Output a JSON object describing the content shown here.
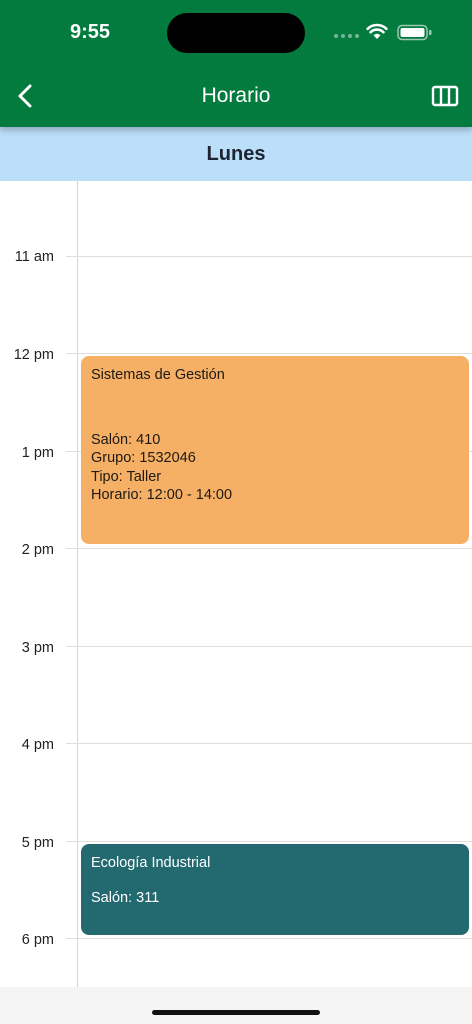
{
  "status_bar": {
    "time": "9:55"
  },
  "nav": {
    "title": "Horario",
    "back_icon": "chevron-left-icon",
    "view_icon": "view-week-icon"
  },
  "day": {
    "label": "Lunes"
  },
  "hours": [
    "11 am",
    "12 pm",
    "1 pm",
    "2 pm",
    "3 pm",
    "4 pm",
    "5 pm",
    "6 pm"
  ],
  "events": [
    {
      "title": "Sistemas de Gestión",
      "salon": "Salón: 410",
      "grupo": "Grupo: 1532046",
      "tipo": "Tipo: Taller",
      "horario": "Horario: 12:00 - 14:00",
      "color": "#f5b066"
    },
    {
      "title": "Ecología Industrial",
      "salon": "Salón: 311",
      "color": "#236a70"
    }
  ],
  "colors": {
    "app_bar": "#037a3e",
    "day_header": "#bbdef9"
  }
}
